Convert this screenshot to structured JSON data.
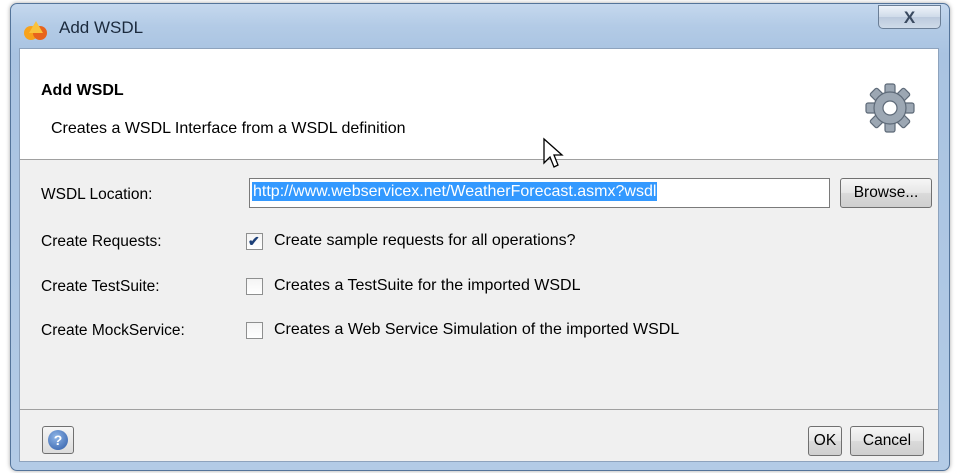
{
  "window": {
    "title": "Add WSDL",
    "close_glyph": "X"
  },
  "header": {
    "title": "Add WSDL",
    "description": "Creates a WSDL Interface from a WSDL definition",
    "icon": "gear-icon"
  },
  "form": {
    "location": {
      "label": "WSDL Location:",
      "value": "http://www.webservicex.net/WeatherForecast.asmx?wsdl",
      "browse_label": "Browse..."
    },
    "requests": {
      "label": "Create Requests:",
      "text": "Create sample requests for all operations?",
      "checked": true
    },
    "testsuite": {
      "label": "Create TestSuite:",
      "text": "Creates a TestSuite for the imported WSDL",
      "checked": false
    },
    "mockservice": {
      "label": "Create MockService:",
      "text": "Creates a Web Service Simulation of the imported WSDL",
      "checked": false
    }
  },
  "footer": {
    "ok_label": "OK",
    "cancel_label": "Cancel",
    "help_glyph": "?"
  },
  "colors": {
    "title_bar": "#b3cbe6",
    "selection": "#3399ff",
    "dialog_bg": "#f0f0f0"
  }
}
